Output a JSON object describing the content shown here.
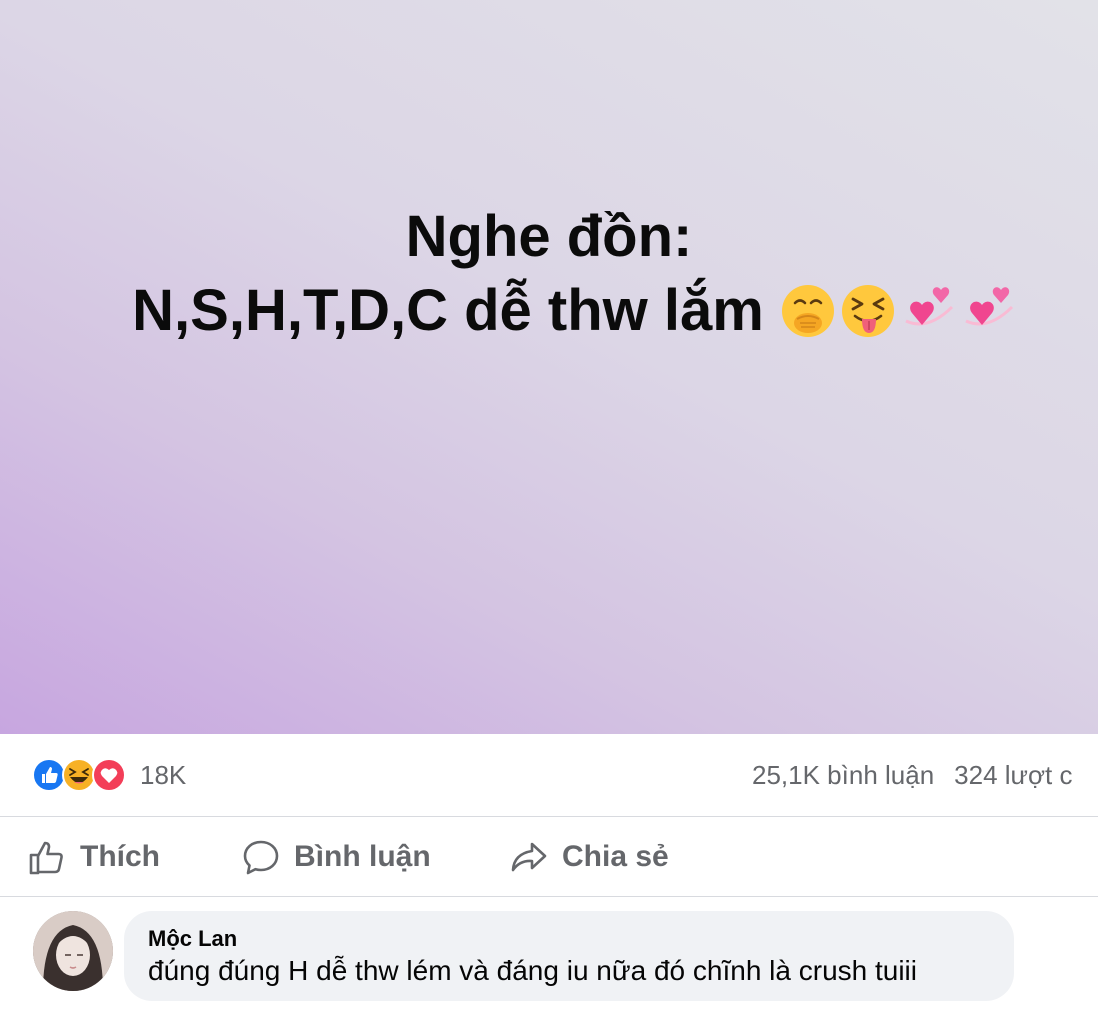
{
  "post": {
    "line1": "Nghe đồn:",
    "line2": "N,S,H,T,D,C dễ thw lắm",
    "emojis": [
      "face-with-hand-over-mouth-icon",
      "squinting-face-with-tongue-icon",
      "revolving-hearts-icon",
      "revolving-hearts-icon"
    ],
    "background": {
      "from": "#c7a6e0",
      "to": "#e2e2e8"
    }
  },
  "reactions": {
    "icons": [
      "like-reaction-icon",
      "haha-reaction-icon",
      "love-reaction-icon"
    ],
    "count": "18K",
    "comments": "25,1K bình luận",
    "shares": "324 lượt c"
  },
  "actions": {
    "like": "Thích",
    "comment": "Bình luận",
    "share": "Chia sẻ"
  },
  "comment": {
    "author": "Mộc Lan",
    "text": "đúng đúng H dễ thw lém và đáng iu nữa đó chĩnh là crush tuiii"
  },
  "colors": {
    "muted_text": "#65676b",
    "like_blue": "#1877f2",
    "love_red": "#f33e58",
    "haha_yellow": "#f7b125",
    "bubble_bg": "#f0f2f5"
  }
}
